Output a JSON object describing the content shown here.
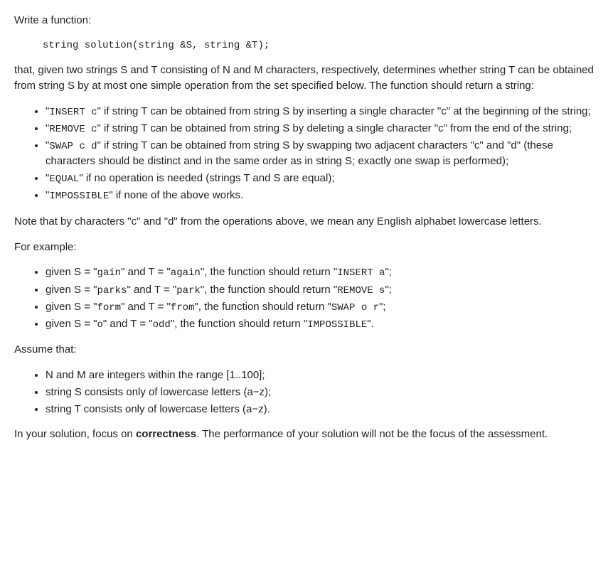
{
  "intro_prompt": "Write a function:",
  "signature": "string solution(string &S, string &T);",
  "desc_part1": "that, given two strings S and T consisting of N and M characters, respectively, determines whether string T can be obtained from string S by at most one simple operation from the set specified below. The function should return a string:",
  "ops": {
    "insert": {
      "code": "INSERT c",
      "text": "\" if string T can be obtained from string S by inserting a single character \"c\" at the beginning of the string;"
    },
    "remove": {
      "code": "REMOVE c",
      "text": "\" if string T can be obtained from string S by deleting a single character \"c\" from the end of the string;"
    },
    "swap": {
      "code": "SWAP c d",
      "text": "\" if string T can be obtained from string S by swapping two adjacent characters \"c\" and \"d\" (these characters should be distinct and in the same order as in string S; exactly one swap is performed);"
    },
    "equal": {
      "code": "EQUAL",
      "text": "\" if no operation is needed (strings T and S are equal);"
    },
    "impossible": {
      "code": "IMPOSSIBLE",
      "text": "\" if none of the above works."
    }
  },
  "note": "Note that by characters \"c\" and \"d\" from the operations above, we mean any English alphabet lowercase letters.",
  "example_intro": "For example:",
  "examples": {
    "e1": {
      "pre": "given S = \"",
      "s": "gain",
      "mid": "\" and T = \"",
      "t": "again",
      "post": "\", the function should return \"",
      "ret": "INSERT a",
      "end": "\";"
    },
    "e2": {
      "pre": "given S = \"",
      "s": "parks",
      "mid": "\" and T = \"",
      "t": "park",
      "post": "\", the function should return \"",
      "ret": "REMOVE s",
      "end": "\";"
    },
    "e3": {
      "pre": "given S = \"",
      "s": "form",
      "mid": "\" and T = \"",
      "t": "from",
      "post": "\", the function should return \"",
      "ret": "SWAP o r",
      "end": "\";"
    },
    "e4": {
      "pre": "given S = \"",
      "s": "o",
      "mid": "\" and T = \"",
      "t": "odd",
      "post": "\", the function should return \"",
      "ret": "IMPOSSIBLE",
      "end": "\"."
    }
  },
  "assume_intro": "Assume that:",
  "assumptions": {
    "a1": "N and M are integers within the range [1..100];",
    "a2": "string S consists only of lowercase letters (a−z);",
    "a3": "string T consists only of lowercase letters (a−z)."
  },
  "closing_pre": "In your solution, focus on ",
  "closing_bold": "correctness",
  "closing_post": ". The performance of your solution will not be the focus of the assessment.",
  "quote_open": "\"",
  "quote_close": ""
}
